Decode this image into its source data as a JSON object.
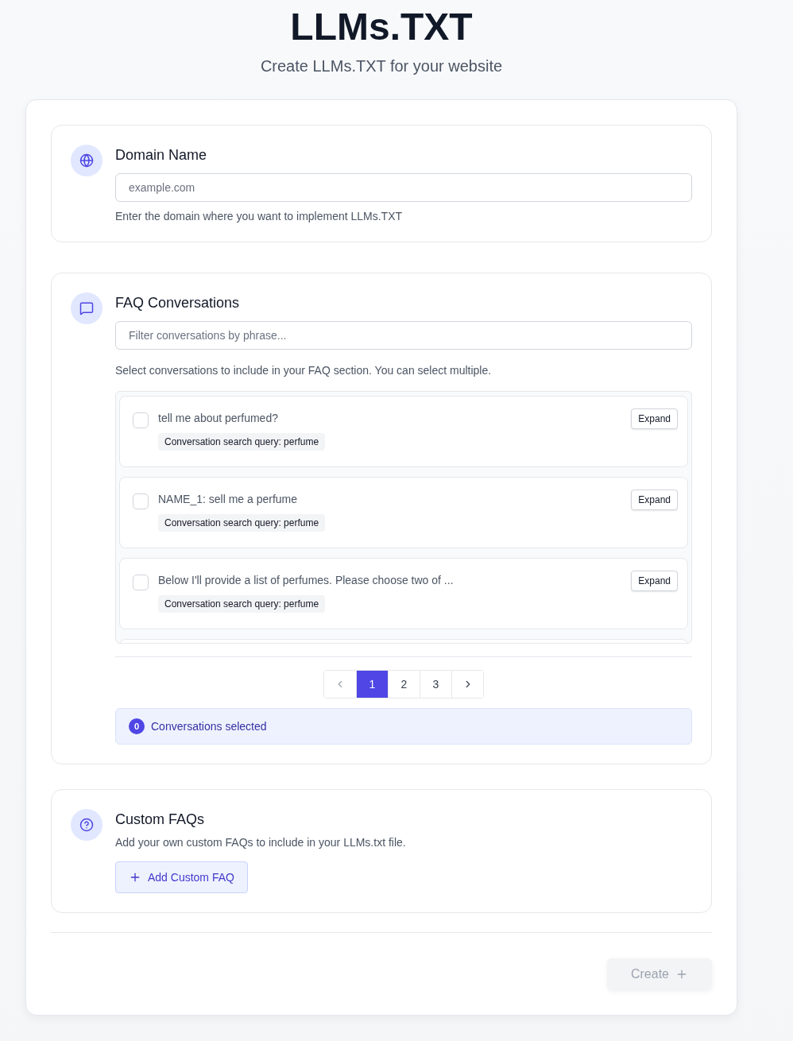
{
  "header": {
    "title": "LLMs.TXT",
    "subtitle": "Create LLMs.TXT for your website"
  },
  "domain": {
    "title": "Domain Name",
    "placeholder": "example.com",
    "help": "Enter the domain where you want to implement LLMs.TXT"
  },
  "faq": {
    "title": "FAQ Conversations",
    "placeholder": "Filter conversations by phrase...",
    "help": "Select conversations to include in your FAQ section. You can select multiple.",
    "conversations": [
      {
        "text": "tell me about perfumed?",
        "tag": "Conversation search query: perfume",
        "button": "Expand",
        "checked": false
      },
      {
        "text": "NAME_1: sell me a perfume",
        "tag": "Conversation search query: perfume",
        "button": "Expand",
        "checked": false
      },
      {
        "text": "Below I'll provide a list of perfumes. Please choose two of ...",
        "tag": "Conversation search query: perfume",
        "button": "Expand",
        "checked": false
      }
    ],
    "pages": [
      {
        "label": "1",
        "selected": true
      },
      {
        "label": "2",
        "selected": false
      },
      {
        "label": "3",
        "selected": false
      }
    ],
    "selected_count": "0",
    "selected_label": "Conversations selected"
  },
  "custom": {
    "title": "Custom FAQs",
    "help": "Add your own custom FAQs to include in your LLMs.txt file.",
    "button": "Add Custom FAQ"
  },
  "create": {
    "label": "Create",
    "disabled": true
  }
}
